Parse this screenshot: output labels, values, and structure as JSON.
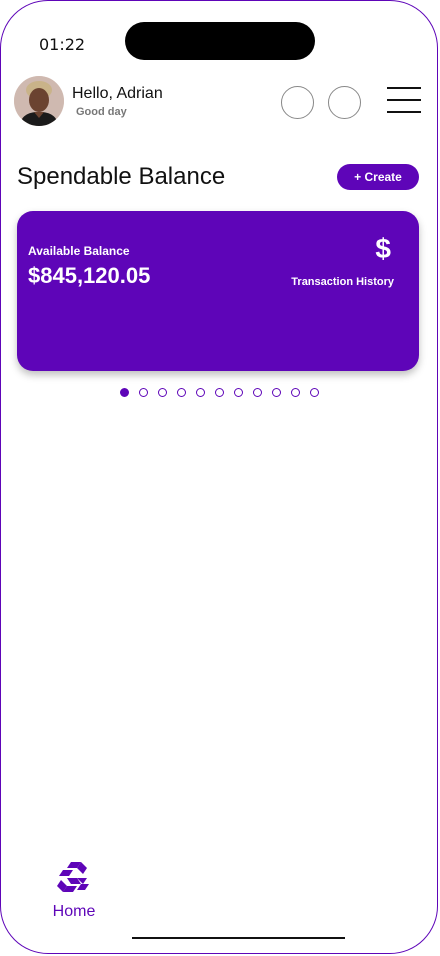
{
  "status_bar": {
    "time": "01:22"
  },
  "header": {
    "greeting": "Hello, Adrian",
    "subtitle": "Good day"
  },
  "balance_section": {
    "title": "Spendable Balance",
    "create_label": "+ Create"
  },
  "card": {
    "balance_label": "Available Balance",
    "balance_amount": "$845,120.05",
    "currency_symbol": "$",
    "history_label": "Transaction History",
    "color": "#5e05b8"
  },
  "pagination": {
    "total": 11,
    "active_index": 0
  },
  "bottom_nav": {
    "home_label": "Home",
    "home_icon": "app-logo-icon"
  },
  "colors": {
    "accent": "#5e05b8"
  }
}
